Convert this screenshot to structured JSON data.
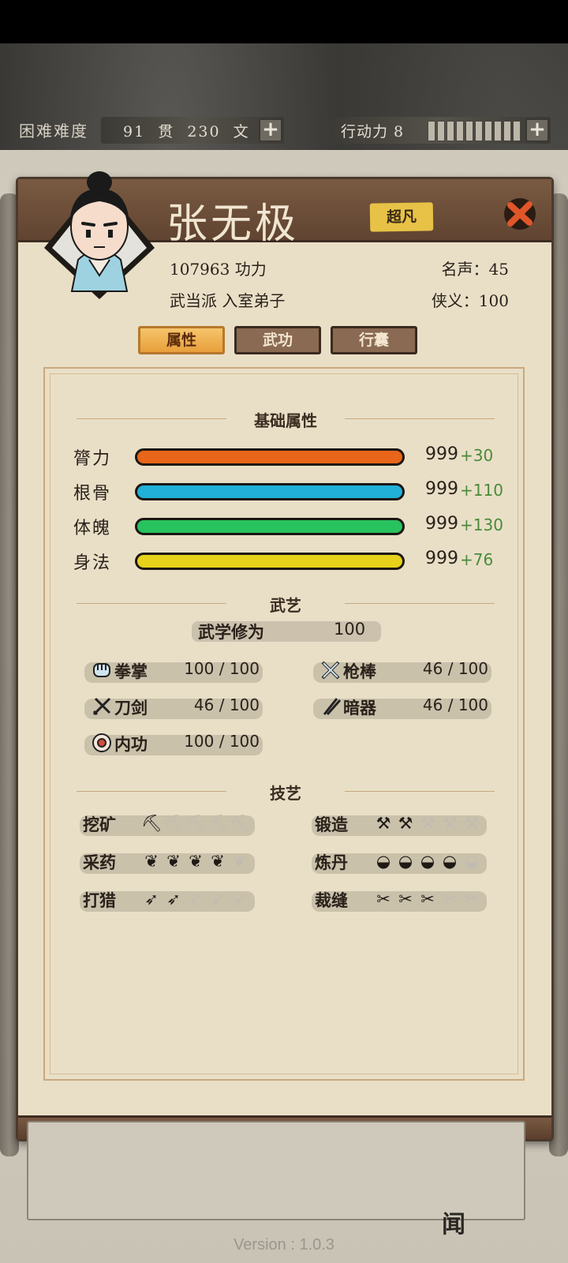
{
  "topbar": {
    "difficulty": "困难难度",
    "money": "91  贯  230  文",
    "action_label": "行动力 8",
    "action_cells": 10
  },
  "hero": {
    "name": "张无极",
    "rank": "超凡",
    "power": "107963 功力",
    "sect": "武当派 入室弟子",
    "fame": "名声：45",
    "chivalry": "侠义：100"
  },
  "tabs": [
    {
      "label": "属性",
      "active": true
    },
    {
      "label": "武功",
      "active": false
    },
    {
      "label": "行囊",
      "active": false
    }
  ],
  "sections": {
    "base": "基础属性",
    "martial": "武艺",
    "crafts": "技艺"
  },
  "attributes": [
    {
      "label": "膂力",
      "value": "999",
      "bonus": "+30",
      "color": "#e8651a"
    },
    {
      "label": "根骨",
      "value": "999",
      "bonus": "+110",
      "color": "#20b0d8"
    },
    {
      "label": "体魄",
      "value": "999",
      "bonus": "+130",
      "color": "#28c25e"
    },
    {
      "label": "身法",
      "value": "999",
      "bonus": "+76",
      "color": "#e6d21a"
    }
  ],
  "martial": {
    "total_label": "武学修为",
    "total_value": "100",
    "skills": [
      {
        "label": "拳掌",
        "value": "100 / 100",
        "icon": "fist-icon"
      },
      {
        "label": "枪棒",
        "value": "46 / 100",
        "icon": "spear-icon"
      },
      {
        "label": "刀剑",
        "value": "46 / 100",
        "icon": "sword-icon"
      },
      {
        "label": "暗器",
        "value": "46 / 100",
        "icon": "dart-icon"
      },
      {
        "label": "内功",
        "value": "100 / 100",
        "icon": "inner-power-icon"
      }
    ]
  },
  "crafts": [
    {
      "label": "挖矿",
      "level": 1,
      "icon": "pickaxe-icon",
      "glyph": "⛏"
    },
    {
      "label": "锻造",
      "level": 2,
      "icon": "anvil-icon",
      "glyph": "⚒"
    },
    {
      "label": "采药",
      "level": 4,
      "icon": "herb-icon",
      "glyph": "❦"
    },
    {
      "label": "炼丹",
      "level": 4,
      "icon": "bowl-icon",
      "glyph": "◒"
    },
    {
      "label": "打猎",
      "level": 2,
      "icon": "bow-icon",
      "glyph": "➶"
    },
    {
      "label": "裁缝",
      "level": 3,
      "icon": "needle-icon",
      "glyph": "✂"
    }
  ],
  "footer": {
    "version": "Version : 1.0.3",
    "corner": "闻"
  }
}
